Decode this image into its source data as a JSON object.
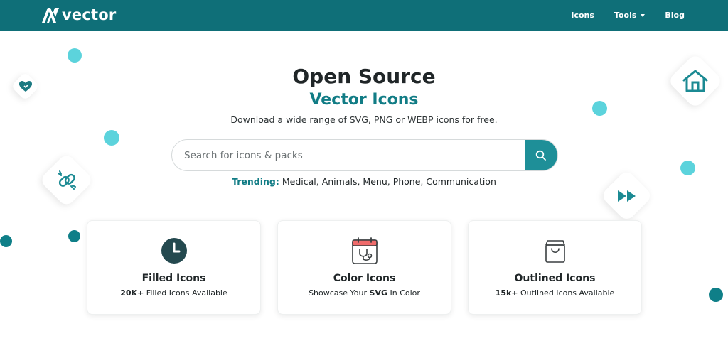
{
  "header": {
    "logo_text": "vector",
    "nav": [
      {
        "label": "Icons"
      },
      {
        "label": "Tools"
      },
      {
        "label": "Blog"
      }
    ]
  },
  "hero": {
    "title": "Open Source",
    "subtitle": "Vector Icons",
    "description": "Download a wide range of SVG, PNG or WEBP icons for free."
  },
  "search": {
    "placeholder": "Search for icons & packs",
    "button_icon": "search-icon"
  },
  "trending": {
    "label": "Trending:",
    "items": "Medical, Animals, Menu, Phone, Communication"
  },
  "cards": [
    {
      "icon": "clock-icon",
      "title": "Filled Icons",
      "desc_bold": "20K+",
      "desc_rest": " Filled Icons Available"
    },
    {
      "icon": "calendar-stethoscope-icon",
      "title": "Color Icons",
      "desc_pre": "Showcase Your ",
      "desc_bold": "SVG",
      "desc_post": " In Color"
    },
    {
      "icon": "shopping-bag-icon",
      "title": "Outlined Icons",
      "desc_bold": "15k+",
      "desc_rest": " Outlined Icons Available"
    }
  ],
  "colors": {
    "header_bg": "#0f6f78",
    "accent": "#117c85",
    "search_button": "#1e8f98",
    "dot_light": "#5cd3dc",
    "dot_dark": "#0f7f88"
  }
}
